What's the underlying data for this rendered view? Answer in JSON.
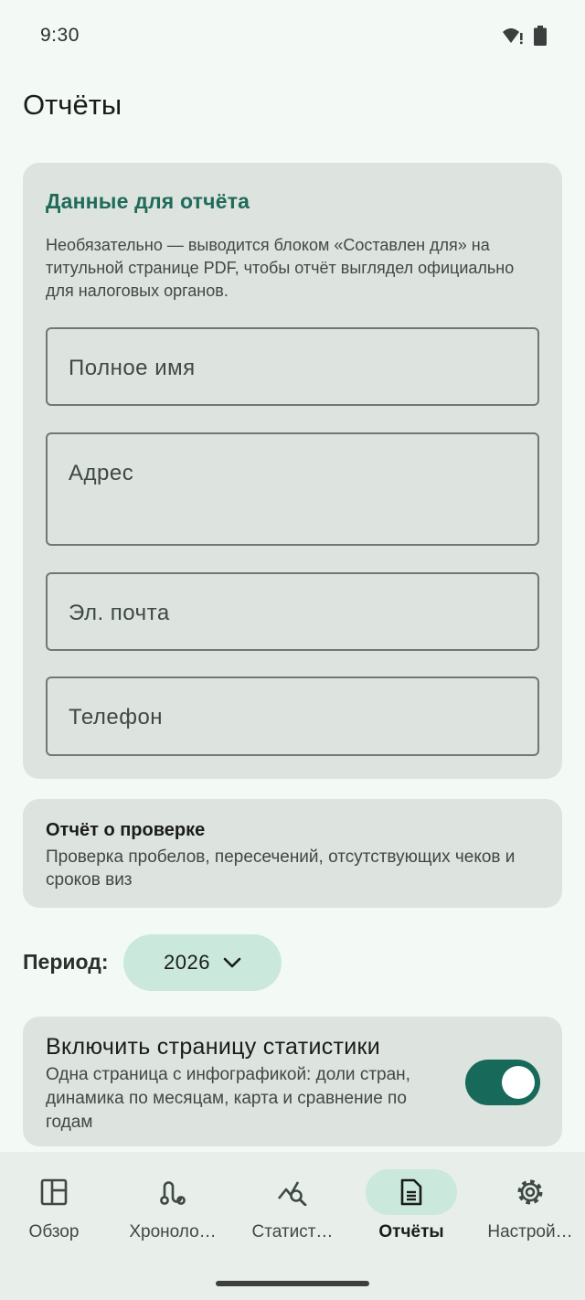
{
  "status_bar": {
    "time": "9:30",
    "icons": [
      "wifi-alert-icon",
      "battery-icon"
    ]
  },
  "page": {
    "title": "Отчёты"
  },
  "contact_card": {
    "title": "Данные для отчёта",
    "description": "Необязательно — выводится блоком «Составлен для» на титульной странице PDF, чтобы отчёт выглядел официально для налоговых органов.",
    "fields": {
      "full_name": "Полное имя",
      "address": "Адрес",
      "email": "Эл. почта",
      "phone": "Телефон"
    }
  },
  "audit_card": {
    "title": "Отчёт о проверке",
    "description": "Проверка пробелов, пересечений, отсутствующих чеков и сроков виз"
  },
  "period": {
    "label": "Период:",
    "value": "2026"
  },
  "stats_card": {
    "title": "Включить страницу статистики",
    "description": "Одна страница с инфографикой: доли стран, динамика по месяцам, карта и сравнение по годам",
    "enabled": true
  },
  "nav": {
    "items": [
      {
        "label": "Обзор",
        "icon": "dashboard-icon"
      },
      {
        "label": "Хроноло…",
        "icon": "route-icon"
      },
      {
        "label": "Статист…",
        "icon": "chart-search-icon"
      },
      {
        "label": "Отчёты",
        "icon": "document-icon",
        "active": true
      },
      {
        "label": "Настрой…",
        "icon": "gear-icon"
      }
    ]
  },
  "colors": {
    "background": "#f3f9f5",
    "card": "#dde3df",
    "accent": "#1f6b5a",
    "chip": "#cbe8dd",
    "toggle_on": "#17695a"
  }
}
